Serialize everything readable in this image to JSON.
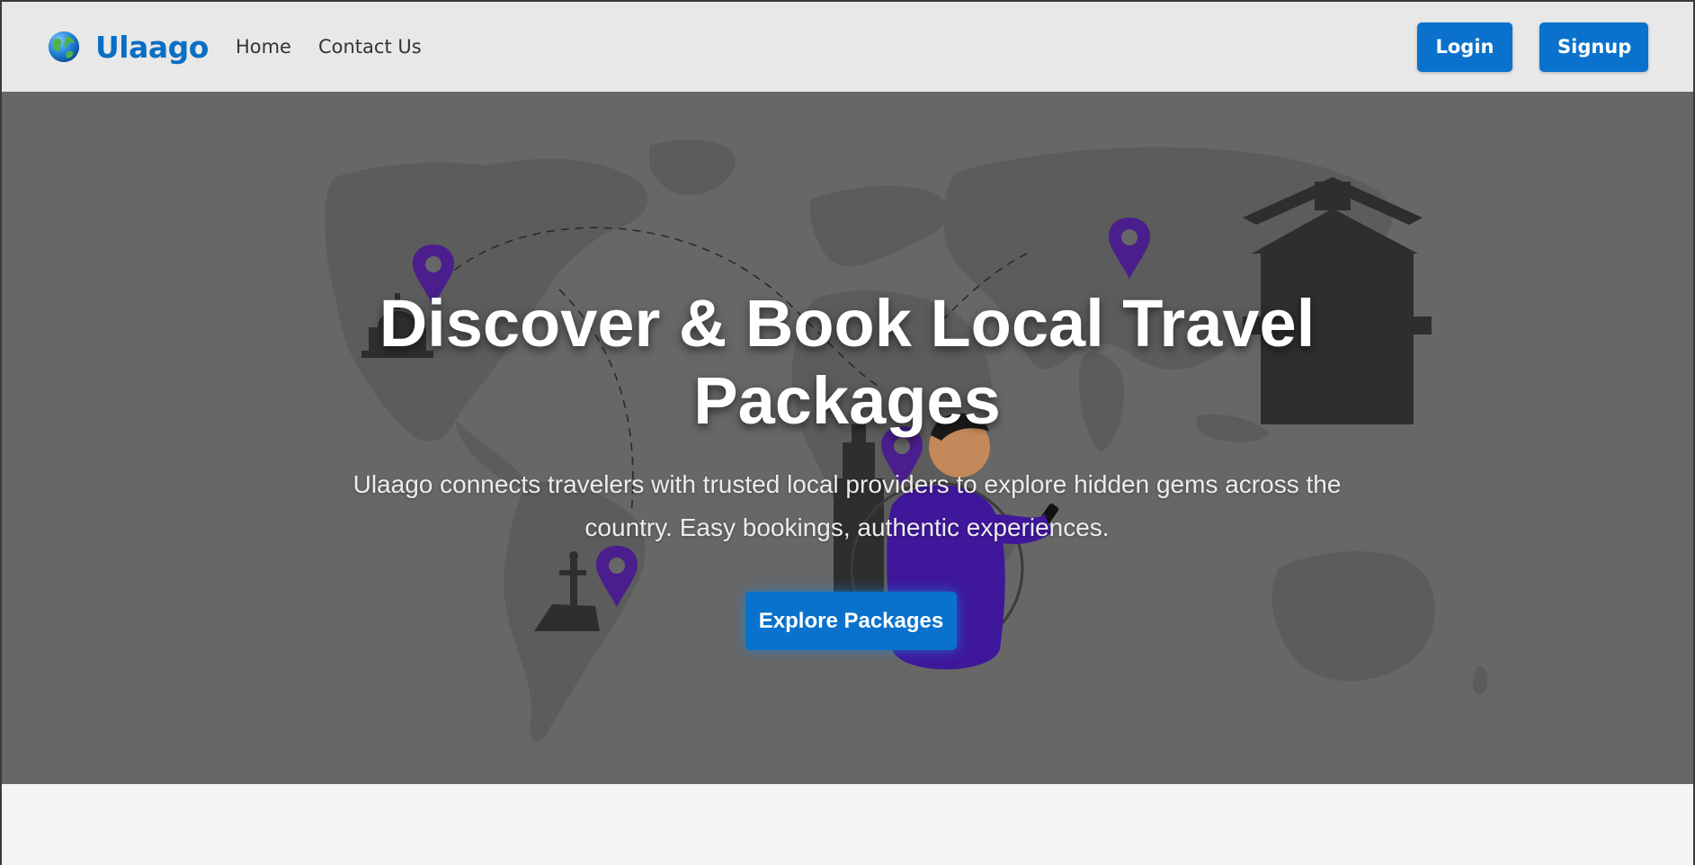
{
  "nav": {
    "brand": "Ulaago",
    "links": [
      {
        "label": "Home"
      },
      {
        "label": "Contact Us"
      }
    ],
    "login_label": "Login",
    "signup_label": "Signup"
  },
  "hero": {
    "title": "Discover & Book Local Travel Packages",
    "subtitle": "Ulaago connects travelers with trusted local providers to explore hidden gems across the country. Easy bookings, authentic experiences.",
    "cta_label": "Explore Packages"
  },
  "colors": {
    "brand": "#0a6fc4",
    "button": "#0a72cc",
    "navbar_bg": "#e8e8e8",
    "hero_overlay": "#676767",
    "map_land": "#5e5e5e",
    "pin": "#4a1e8c"
  },
  "icons": {
    "brand": "globe-icon",
    "pins": "map-pin-icon"
  }
}
